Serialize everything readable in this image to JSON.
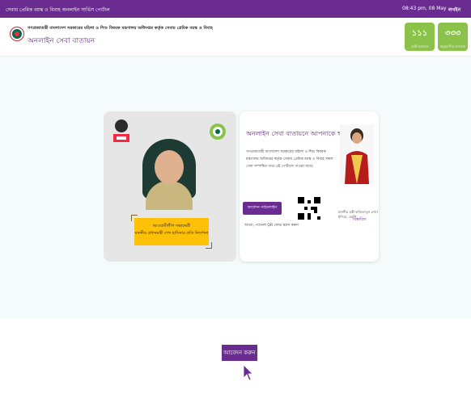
{
  "topbar": {
    "portal_label": "সেবায় প্রেমিক বয়স্ক ও বিবাহ অনলাইন সার্ভিস পোর্টাল",
    "time": "08:43 pm, 08 May",
    "login_label": "লগইন"
  },
  "header": {
    "title": "গণপ্রজাতন্ত্রী বাংলাদেশ সরকারের মহিলা ও শিশু বিষয়ক মন্ত্রণালয় অধিদপ্তর কর্তৃক সেবায় প্রেমিক বয়স্ক ও বিবাহ",
    "subtitle": "অনলাইন সেবা বাতায়ন",
    "stats": [
      {
        "number": "১১১",
        "label": "মোট আবেদন"
      },
      {
        "number": "৩৩৩",
        "label": "অনুমোদিত আবেদন"
      }
    ]
  },
  "colors": {
    "brand": "#6a2c91",
    "accent": "#8bc34a",
    "highlight": "#ffc107"
  },
  "left_card": {
    "caption_line1": "আওয়ামীলীগ সভানেত্রী",
    "caption_line2": "মাননীয় প্রধানমন্ত্রী শেখ হাসিনার প্রতি নির্দেশনা"
  },
  "right_card": {
    "welcome": "অনলাইন সেবা বাতায়নে আপনাকে স্বাগতম",
    "body": "গণপ্রজাতন্ত্রী বাংলাদেশ সরকারের মহিলা ও শিশু বিষয়ক মন্ত্রণালয় অধিদপ্তর কর্তৃক সেবায় প্রেমিক বয়স্ক ও বিবাহ সকল সেবা সম্পর্কিত তথ্য এই পোর্টালে পাওয়া যাবে।",
    "guide_button": "আবেদন গাইডলাইন",
    "qr_note": "অথবা, প্যানেল QR কোড স্ক্যান করুন",
    "officer_name": "মাননীয় মন্ত্রী ফজিলাতুন নেসা ইন্দিরা, এমপি",
    "officer_title": "বিস্তারিত"
  },
  "apply_button": "আবেদন করুন"
}
